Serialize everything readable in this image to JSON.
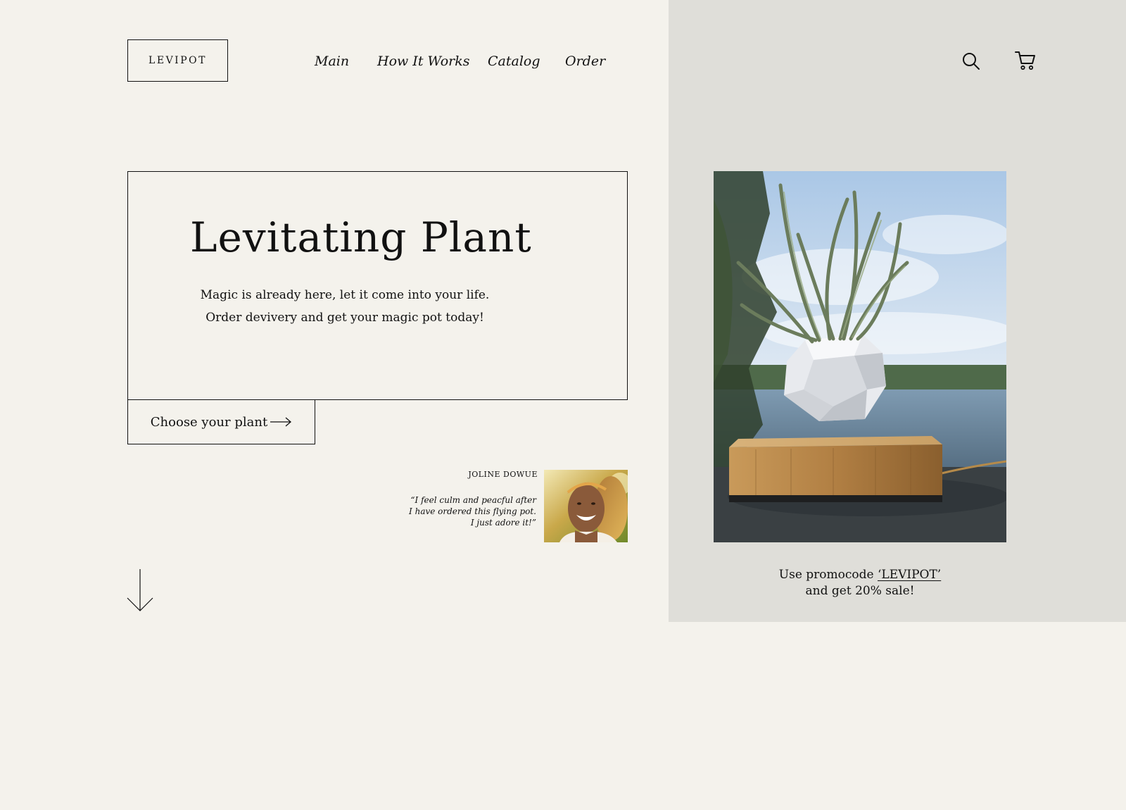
{
  "header": {
    "logo": "LEVIPOT",
    "nav": [
      "Main",
      "How It Works",
      "Catalog",
      "Order"
    ],
    "icons": [
      "search-icon",
      "cart-icon"
    ]
  },
  "hero": {
    "title": "Levitating Plant",
    "subtitle_line1": "Magic is already here, let it come into your life.",
    "subtitle_line2": "Order devivery and get your magic pot today!",
    "cta_label": "Choose your plant"
  },
  "testimonial": {
    "name": "JOLINE DOWUE",
    "quote_line1": "“I feel culm and peacful after",
    "quote_line2": "I have ordered this flying pot.",
    "quote_line3": "I just adore it!”"
  },
  "promo": {
    "prefix": "Use promocode ",
    "code": "‘LEVIPOT’",
    "line2": "and get 20% sale!"
  },
  "colors": {
    "background": "#f4f2ec",
    "panel": "#dfded9",
    "text": "#111111"
  }
}
